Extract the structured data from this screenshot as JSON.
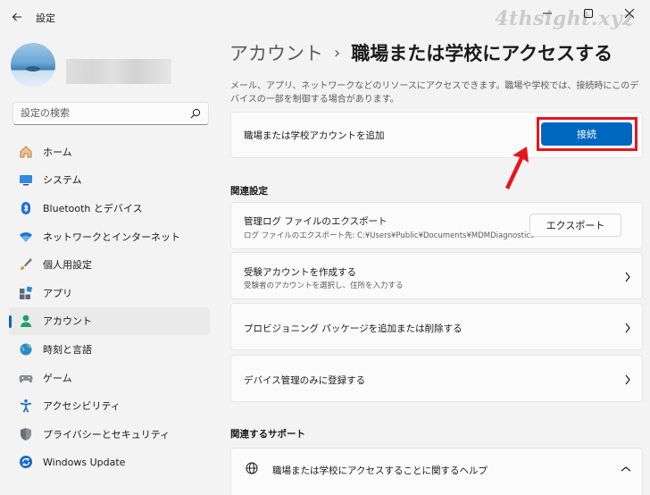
{
  "window": {
    "title": "設定",
    "watermark": "4thsight.xyz"
  },
  "sidebar": {
    "search_placeholder": "設定の検索",
    "items": [
      {
        "label": "ホーム",
        "icon": "home-icon"
      },
      {
        "label": "システム",
        "icon": "system-icon"
      },
      {
        "label": "Bluetooth とデバイス",
        "icon": "bluetooth-icon"
      },
      {
        "label": "ネットワークとインターネット",
        "icon": "wifi-icon"
      },
      {
        "label": "個人用設定",
        "icon": "brush-icon"
      },
      {
        "label": "アプリ",
        "icon": "apps-icon"
      },
      {
        "label": "アカウント",
        "icon": "account-icon",
        "active": true
      },
      {
        "label": "時刻と言語",
        "icon": "time-language-icon"
      },
      {
        "label": "ゲーム",
        "icon": "gamepad-icon"
      },
      {
        "label": "アクセシビリティ",
        "icon": "accessibility-icon"
      },
      {
        "label": "プライバシーとセキュリティ",
        "icon": "shield-icon"
      },
      {
        "label": "Windows Update",
        "icon": "update-icon"
      }
    ]
  },
  "main": {
    "breadcrumb_parent": "アカウント",
    "breadcrumb_sep": "›",
    "breadcrumb_current": "職場または学校にアクセスする",
    "description": "メール、アプリ、ネットワークなどのリソースにアクセスできます。職場や学校では、接続時にこのデバイスの一部を制御する場合があります。",
    "add_account": {
      "label": "職場または学校アカウントを追加",
      "button": "接続"
    },
    "related_settings_title": "関連設定",
    "export_logs": {
      "label": "管理ログ ファイルのエクスポート",
      "sub": "ログ ファイルのエクスポート先: C:¥Users¥Public¥Documents¥MDMDiagnostics",
      "button": "エクスポート"
    },
    "test_account": {
      "label": "受験アカウントを作成する",
      "sub": "受験者のアカウントを選択し、住所を入力する"
    },
    "provisioning": {
      "label": "プロビジョニング パッケージを追加または削除する"
    },
    "device_management": {
      "label": "デバイス管理のみに登録する"
    },
    "related_support_title": "関連するサポート",
    "help": {
      "label": "職場または学校にアクセスすることに関するヘルプ"
    }
  },
  "colors": {
    "accent": "#0067c0",
    "highlight": "#e8141e"
  }
}
